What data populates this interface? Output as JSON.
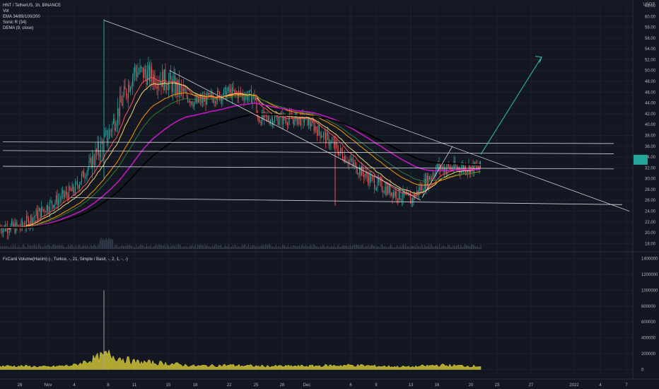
{
  "header": {
    "symbol_line": "HNT / TetherUS, 1h, BINANCE",
    "indicators": [
      "Vol",
      "EMA 34/89/100/200",
      "Sonic R (34)",
      "DEMA (9, close)"
    ],
    "currency": "USDT"
  },
  "volume_panel": {
    "legend": "FxCanli Volume(Hacim) (-, Turkce, -, 21, Simple / Basit, -, 2, 1, -, -)"
  },
  "colors": {
    "background": "#131722",
    "up_candle": "#26a69a",
    "down_candle": "#ef5350",
    "ema34": "#f5d76e",
    "ema89": "#ff9800",
    "ema100": "#2e7d32",
    "ema200": "#000000",
    "sonic": "#c218c2",
    "trendline": "#d1d4dc",
    "arrow": "#2ec4b6",
    "current_price_box": "#26a69a",
    "volume_area": "#e6d83a"
  },
  "chart_data": [
    {
      "type": "candlestick",
      "title": "HNT / TetherUS, 1h, BINANCE",
      "ylabel": "USDT",
      "ylim": [
        17,
        62
      ],
      "y_ticks": [
        18,
        20,
        22,
        24,
        26,
        28,
        30,
        32,
        34,
        36,
        38,
        40,
        42,
        44,
        46,
        48,
        50,
        52,
        54,
        56,
        58,
        60,
        62
      ],
      "x_tick_labels": [
        "28",
        "Nov",
        "4",
        "8",
        "11",
        "15",
        "18",
        "22",
        "25",
        "28",
        "Dec",
        "6",
        "9",
        "13",
        "16",
        "20",
        "23",
        "27",
        "2022",
        "4",
        "7"
      ],
      "price_path": [
        [
          "28",
          21
        ],
        [
          "Nov",
          25
        ],
        [
          "4",
          28
        ],
        [
          "8",
          38
        ],
        [
          "11",
          50
        ],
        [
          "15",
          48
        ],
        [
          "18",
          44
        ],
        [
          "22",
          46
        ],
        [
          "25",
          45
        ],
        [
          "28",
          42
        ],
        [
          "Dec",
          41
        ],
        [
          "6",
          33
        ],
        [
          "9",
          29
        ],
        [
          "13",
          26
        ],
        [
          "16",
          32
        ],
        [
          "20",
          32
        ]
      ],
      "last_price": 33.5,
      "grid": true
    },
    {
      "type": "area",
      "title": "FxCanli Volume(Hacim) (-, Turkce, -, 21, Simple / Basit, -, 2, 1, -, -)",
      "ylim": [
        -50000,
        1450000
      ],
      "y_ticks": [
        0,
        200000,
        400000,
        600000,
        800000,
        1000000,
        1200000,
        1400000
      ],
      "x_tick_labels": [
        "28",
        "Nov",
        "4",
        "8",
        "11",
        "15",
        "18",
        "22",
        "25",
        "28",
        "Dec",
        "6",
        "9",
        "13",
        "16",
        "20",
        "23",
        "27",
        "2022",
        "4",
        "7"
      ],
      "volume_path": [
        [
          "28",
          40000
        ],
        [
          "Nov",
          30000
        ],
        [
          "4",
          50000
        ],
        [
          "8",
          180000
        ],
        [
          "11",
          90000
        ],
        [
          "15",
          70000
        ],
        [
          "18",
          40000
        ],
        [
          "22",
          50000
        ],
        [
          "25",
          40000
        ],
        [
          "28",
          30000
        ],
        [
          "Dec",
          40000
        ],
        [
          "6",
          50000
        ],
        [
          "9",
          40000
        ],
        [
          "13",
          30000
        ],
        [
          "16",
          50000
        ],
        [
          "20",
          40000
        ]
      ],
      "spike_value": 1000000,
      "grid": true
    }
  ]
}
